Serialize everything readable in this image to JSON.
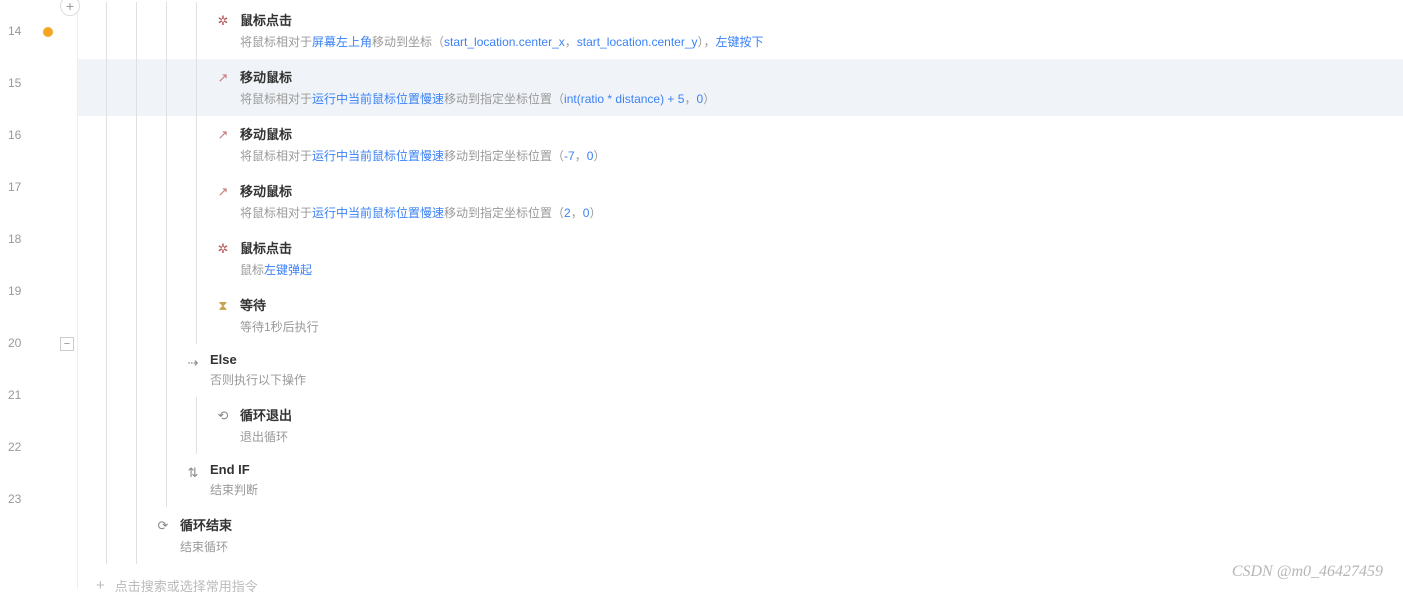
{
  "lines": [
    14,
    15,
    16,
    17,
    18,
    19,
    20,
    21,
    22,
    23
  ],
  "gutter": {
    "badge_line": 14,
    "collapse_line": 20
  },
  "steps": [
    {
      "indent": 3,
      "icon": "click",
      "title": "鼠标点击",
      "desc_parts": [
        {
          "t": "plain",
          "v": "将鼠标相对于"
        },
        {
          "t": "link",
          "v": "屏幕左上角"
        },
        {
          "t": "plain",
          "v": "移动到坐标（"
        },
        {
          "t": "var",
          "v": "start_location.center_x"
        },
        {
          "t": "sep",
          "v": "，"
        },
        {
          "t": "var",
          "v": "start_location.center_y"
        },
        {
          "t": "plain",
          "v": "），"
        },
        {
          "t": "link",
          "v": "左键按下"
        }
      ]
    },
    {
      "indent": 3,
      "highlight": true,
      "icon": "move",
      "title": "移动鼠标",
      "desc_parts": [
        {
          "t": "plain",
          "v": "将鼠标相对于"
        },
        {
          "t": "link",
          "v": "运行中当前鼠标位置慢速"
        },
        {
          "t": "plain",
          "v": "移动到指定坐标位置（"
        },
        {
          "t": "var",
          "v": "int(ratio * distance) + 5"
        },
        {
          "t": "sep",
          "v": "，"
        },
        {
          "t": "var",
          "v": "0"
        },
        {
          "t": "plain",
          "v": "）"
        }
      ]
    },
    {
      "indent": 3,
      "icon": "move",
      "title": "移动鼠标",
      "desc_parts": [
        {
          "t": "plain",
          "v": "将鼠标相对于"
        },
        {
          "t": "link",
          "v": "运行中当前鼠标位置慢速"
        },
        {
          "t": "plain",
          "v": "移动到指定坐标位置（"
        },
        {
          "t": "var",
          "v": "-7"
        },
        {
          "t": "sep",
          "v": "，"
        },
        {
          "t": "var",
          "v": "0"
        },
        {
          "t": "plain",
          "v": "）"
        }
      ]
    },
    {
      "indent": 3,
      "icon": "move",
      "title": "移动鼠标",
      "desc_parts": [
        {
          "t": "plain",
          "v": "将鼠标相对于"
        },
        {
          "t": "link",
          "v": "运行中当前鼠标位置慢速"
        },
        {
          "t": "plain",
          "v": "移动到指定坐标位置（"
        },
        {
          "t": "var",
          "v": "2"
        },
        {
          "t": "sep",
          "v": "，"
        },
        {
          "t": "var",
          "v": "0"
        },
        {
          "t": "plain",
          "v": "）"
        }
      ]
    },
    {
      "indent": 3,
      "icon": "click",
      "title": "鼠标点击",
      "desc_parts": [
        {
          "t": "plain",
          "v": "鼠标"
        },
        {
          "t": "link",
          "v": "左键弹起"
        }
      ]
    },
    {
      "indent": 3,
      "icon": "wait",
      "title": "等待",
      "desc_parts": [
        {
          "t": "plain",
          "v": "等待1秒后执行"
        }
      ]
    },
    {
      "indent": 2,
      "icon": "else",
      "title": "Else",
      "desc_parts": [
        {
          "t": "plain",
          "v": "否则执行以下操作"
        }
      ]
    },
    {
      "indent": 3,
      "icon": "loopexit",
      "title": "循环退出",
      "desc_parts": [
        {
          "t": "plain",
          "v": "退出循环"
        }
      ]
    },
    {
      "indent": 2,
      "icon": "endif",
      "title": "End IF",
      "desc_parts": [
        {
          "t": "plain",
          "v": "结束判断"
        }
      ]
    },
    {
      "indent": 1,
      "icon": "loopend",
      "title": "循环结束",
      "desc_parts": [
        {
          "t": "plain",
          "v": "结束循环"
        }
      ]
    }
  ],
  "add_prompt": "点击搜索或选择常用指令",
  "watermark": "CSDN @m0_46427459"
}
